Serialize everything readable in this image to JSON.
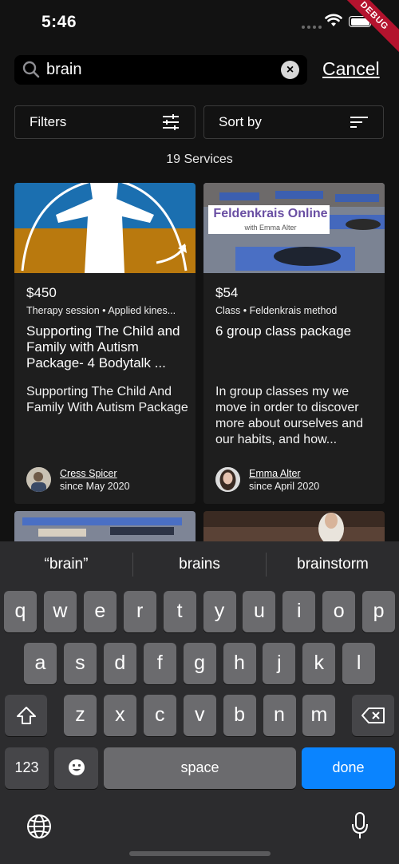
{
  "status_bar": {
    "time": "5:46"
  },
  "debug_banner": "DEBUG",
  "search": {
    "value": "brain",
    "cancel_label": "Cancel"
  },
  "filters": {
    "filters_label": "Filters",
    "sort_label": "Sort by"
  },
  "results_count": "19 Services",
  "cards": [
    {
      "price": "$450",
      "meta": "Therapy session • Applied kines...",
      "title": "Supporting  The Child and Family with Autism Package-  4 Bodytalk ...",
      "description": "Supporting The Child And Family With Autism Package",
      "author": "Cress Spicer",
      "since": "since May 2020"
    },
    {
      "price": "$54",
      "meta": "Class • Feldenkrais method",
      "title": "6 group class package",
      "description": "In group classes my we move in order to discover more about ourselves and our habits, and how...",
      "author": "Emma Alter",
      "since": "since April 2020",
      "image_title": "Feldenkrais Online",
      "image_subtitle": "with Emma Alter"
    }
  ],
  "keyboard": {
    "suggestions": [
      "“brain”",
      "brains",
      "brainstorm"
    ],
    "row1": [
      "q",
      "w",
      "e",
      "r",
      "t",
      "y",
      "u",
      "i",
      "o",
      "p"
    ],
    "row2": [
      "a",
      "s",
      "d",
      "f",
      "g",
      "h",
      "j",
      "k",
      "l"
    ],
    "row3": [
      "z",
      "x",
      "c",
      "v",
      "b",
      "n",
      "m"
    ],
    "numbers_label": "123",
    "space_label": "space",
    "done_label": "done"
  },
  "colors": {
    "background": "#121212",
    "card": "#1e1e1e",
    "accent_blue": "#0a84ff",
    "debug_red": "#b4132e"
  }
}
